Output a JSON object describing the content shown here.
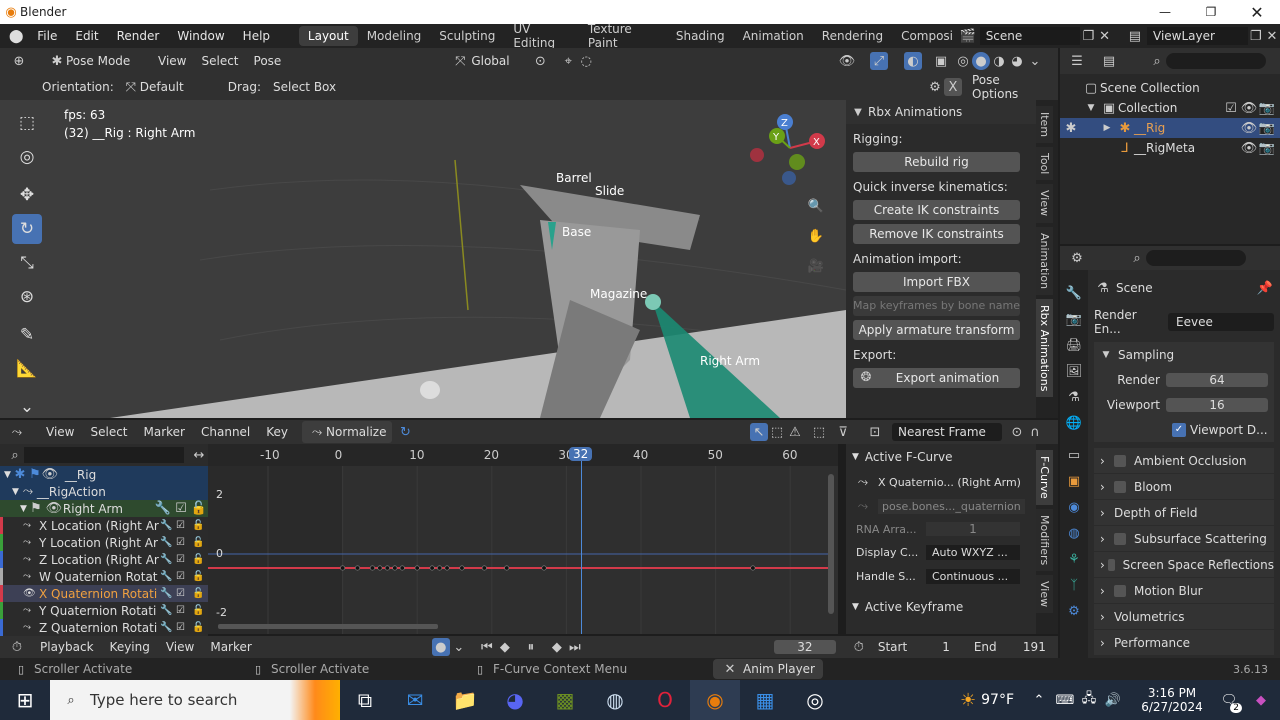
{
  "window": {
    "title": "Blender"
  },
  "menu": {
    "items": [
      "File",
      "Edit",
      "Render",
      "Window",
      "Help"
    ]
  },
  "workspaces": [
    "Layout",
    "Modeling",
    "Sculpting",
    "UV Editing",
    "Texture Paint",
    "Shading",
    "Animation",
    "Rendering",
    "Compositin"
  ],
  "scene": {
    "label": "Scene",
    "viewlayer": "ViewLayer"
  },
  "viewport_header": {
    "mode": "Pose Mode",
    "menus": [
      "View",
      "Select",
      "Pose"
    ],
    "transform": "Global",
    "orientation_label": "Orientation:",
    "orientation_value": "Default",
    "drag_label": "Drag:",
    "drag_value": "Select Box",
    "pose_options": "Pose Options"
  },
  "viewport_overlay": {
    "fps": "fps: 63",
    "info": "(32) __Rig : Right Arm"
  },
  "bones": [
    "Barrel",
    "Slide",
    "Base",
    "Magazine",
    "Right Arm"
  ],
  "n_panel": {
    "header": "Rbx Animations",
    "rigging": "Rigging:",
    "rebuild": "Rebuild rig",
    "qik": "Quick inverse kinematics:",
    "create_ik": "Create IK constraints",
    "remove_ik": "Remove IK constraints",
    "anim_import": "Animation import:",
    "import_fbx": "Import FBX",
    "map_keyframes": "Map keyframes by bone name",
    "apply_armature": "Apply armature transform",
    "export": "Export:",
    "export_anim": "Export animation",
    "tabs": [
      "Item",
      "Tool",
      "View",
      "Animation",
      "Rbx Animations"
    ]
  },
  "outliner": {
    "scene_collection": "Scene Collection",
    "collection": "Collection",
    "rig": "__Rig",
    "rigmeta": "__RigMeta"
  },
  "properties": {
    "scene": "Scene",
    "render_engine_label": "Render En...",
    "render_engine": "Eevee",
    "sampling": "Sampling",
    "render_label": "Render",
    "render_val": "64",
    "viewport_label": "Viewport",
    "viewport_val": "16",
    "viewport_denoise": "Viewport D...",
    "panels": [
      "Ambient Occlusion",
      "Bloom",
      "Depth of Field",
      "Subsurface Scattering",
      "Screen Space Reflections",
      "Motion Blur",
      "Volumetrics",
      "Performance"
    ]
  },
  "graph": {
    "menus": [
      "View",
      "Select",
      "Marker",
      "Channel",
      "Key"
    ],
    "normalize": "Normalize",
    "pivot": "Nearest Frame",
    "frames": [
      "-10",
      "0",
      "10",
      "20",
      "30",
      "40",
      "50",
      "60"
    ],
    "current_frame": "32",
    "y_ticks": [
      "2",
      "0",
      "-2"
    ]
  },
  "channels": [
    "__Rig",
    "__RigAction",
    "Right Arm",
    "X Location (Right Ar",
    "Y Location (Right Ar",
    "Z Location (Right Ar",
    "W Quaternion Rotat",
    "X Quaternion Rotati",
    "Y Quaternion Rotati",
    "Z Quaternion Rotati"
  ],
  "fcurve_panel": {
    "active": "Active F-Curve",
    "name": "X Quaternio... (Right Arm)",
    "path": "pose.bones..._quaternion",
    "rna_label": "RNA Arra...",
    "rna_val": "1",
    "display_label": "Display C...",
    "display_val": "Auto WXYZ ...",
    "handle_label": "Handle S...",
    "handle_val": "Continuous ...",
    "active_key": "Active Keyframe",
    "tabs": [
      "F-Curve",
      "Modifiers",
      "View"
    ]
  },
  "timeline": {
    "menus": [
      "Playback",
      "Keying",
      "View",
      "Marker"
    ],
    "frame": "32",
    "start_label": "Start",
    "start": "1",
    "end_label": "End",
    "end": "191"
  },
  "status": {
    "left1": "Scroller Activate",
    "left2": "Scroller Activate",
    "mid": "F-Curve Context Menu",
    "anim": "Anim Player",
    "version": "3.6.13"
  },
  "taskbar": {
    "search": "Type here to search",
    "temp": "97°F",
    "time": "3:16 PM",
    "date": "6/27/2024",
    "notif": "2"
  }
}
